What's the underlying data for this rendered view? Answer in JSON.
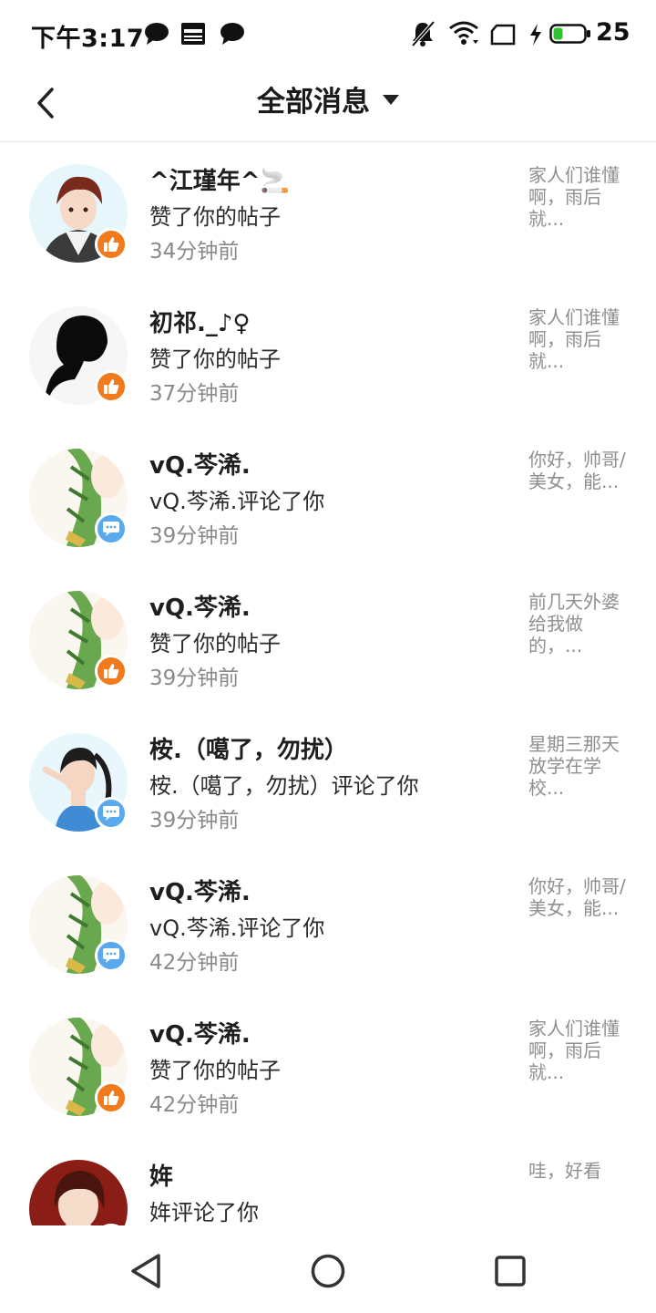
{
  "status_bar": {
    "time": "下午3:17",
    "battery_level": "25",
    "notification_icons": [
      "chat-bubble-icon",
      "news-icon",
      "chat-bubble-icon"
    ],
    "system_icons": [
      "bell-muted-icon",
      "wifi-icon",
      "sim-icon",
      "charging-bolt-icon",
      "battery-icon"
    ]
  },
  "header": {
    "title": "全部消息",
    "back_icon": "chevron-left-icon",
    "dropdown_icon": "caret-down-icon"
  },
  "colors": {
    "like_badge": "#f07a1c",
    "comment_badge": "#5aa9ee",
    "muted_text": "#8a8a8a"
  },
  "messages": [
    {
      "name": "^江瑾年^🚬",
      "action": "赞了你的帖子",
      "time": "34分钟前",
      "preview": "家人们谁懂啊，雨后就...",
      "type": "like"
    },
    {
      "name": "初祁._♪♀",
      "action": "赞了你的帖子",
      "time": "37分钟前",
      "preview": "家人们谁懂啊，雨后就...",
      "type": "like"
    },
    {
      "name": "vQ.芩浠.",
      "action": "vQ.芩浠.评论了你",
      "time": "39分钟前",
      "preview": "你好，帅哥/美女，能...",
      "type": "comment"
    },
    {
      "name": "vQ.芩浠.",
      "action": "赞了你的帖子",
      "time": "39分钟前",
      "preview": "前几天外婆给我做的，...",
      "type": "like"
    },
    {
      "name": "桉.（噶了，勿扰）",
      "action": "桉.（噶了，勿扰）评论了你",
      "time": "39分钟前",
      "preview": "星期三那天放学在学校...",
      "type": "comment"
    },
    {
      "name": "vQ.芩浠.",
      "action": "vQ.芩浠.评论了你",
      "time": "42分钟前",
      "preview": "你好，帅哥/美女，能...",
      "type": "comment"
    },
    {
      "name": "vQ.芩浠.",
      "action": "赞了你的帖子",
      "time": "42分钟前",
      "preview": "家人们谁懂啊，雨后就...",
      "type": "like"
    },
    {
      "name": "姩",
      "action": "姩评论了你",
      "time": "",
      "preview": "哇，好看",
      "type": "comment"
    }
  ],
  "nav_bar": {
    "buttons": [
      "triangle-back-icon",
      "circle-home-icon",
      "square-recents-icon"
    ]
  }
}
